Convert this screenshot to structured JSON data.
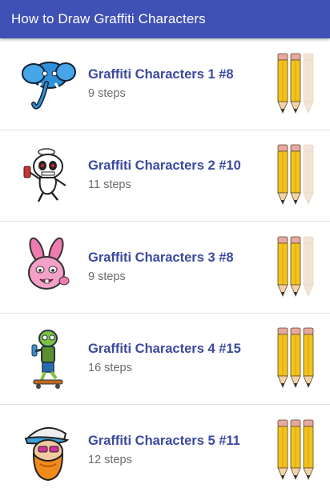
{
  "app": {
    "title": "How to Draw Graffiti Characters"
  },
  "items": [
    {
      "title": "Graffiti Characters 1 #8",
      "steps": "9 steps",
      "difficulty": 2,
      "difficulty_max": 3,
      "thumb_icon": "blue-elephant-icon"
    },
    {
      "title": "Graffiti Characters 2 #10",
      "steps": "11 steps",
      "difficulty": 2,
      "difficulty_max": 3,
      "thumb_icon": "white-ghost-character-icon"
    },
    {
      "title": "Graffiti Characters 3 #8",
      "steps": "9 steps",
      "difficulty": 2,
      "difficulty_max": 3,
      "thumb_icon": "pink-bunny-icon"
    },
    {
      "title": "Graffiti Characters 4 #15",
      "steps": "16 steps",
      "difficulty": 3,
      "difficulty_max": 3,
      "thumb_icon": "green-zombie-skater-icon"
    },
    {
      "title": "Graffiti Characters 5 #11",
      "steps": "12 steps",
      "difficulty": 3,
      "difficulty_max": 3,
      "thumb_icon": "bearded-man-cap-icon"
    }
  ],
  "colors": {
    "appbar": "#3f51b5",
    "title_text": "#3b4a9e",
    "pencil_active": "#f2c31b",
    "pencil_inactive": "#f3e4d6"
  }
}
